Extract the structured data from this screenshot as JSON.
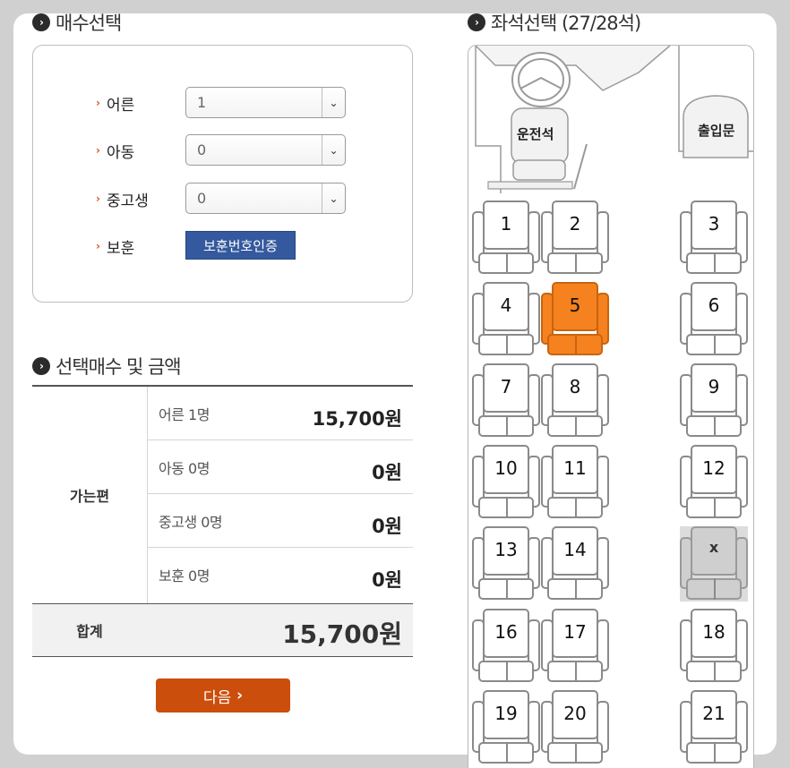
{
  "ticket_count": {
    "title": "매수선택",
    "rows": [
      {
        "label": "어른",
        "value": "1"
      },
      {
        "label": "아동",
        "value": "0"
      },
      {
        "label": "중고생",
        "value": "0"
      }
    ],
    "veteran_label": "보훈",
    "veteran_button": "보훈번호인증"
  },
  "summary": {
    "title": "선택매수 및 금액",
    "direction": "가는편",
    "items": [
      {
        "label": "어른 1명",
        "amount": "15,700원"
      },
      {
        "label": "아동 0명",
        "amount": "0원"
      },
      {
        "label": "중고생 0명",
        "amount": "0원"
      },
      {
        "label": "보훈 0명",
        "amount": "0원"
      }
    ],
    "total_label": "합계",
    "total_amount": "15,700원"
  },
  "next_button": "다음",
  "seat_map": {
    "title": "좌석선택 (27/28석)",
    "driver_label": "운전석",
    "door_label": "출입문",
    "selected_color": "#f5821f",
    "seats": [
      {
        "label": "1",
        "state": "available"
      },
      {
        "label": "2",
        "state": "available"
      },
      {
        "label": "3",
        "state": "available"
      },
      {
        "label": "4",
        "state": "available"
      },
      {
        "label": "5",
        "state": "selected"
      },
      {
        "label": "6",
        "state": "available"
      },
      {
        "label": "7",
        "state": "available"
      },
      {
        "label": "8",
        "state": "available"
      },
      {
        "label": "9",
        "state": "available"
      },
      {
        "label": "10",
        "state": "available"
      },
      {
        "label": "11",
        "state": "available"
      },
      {
        "label": "12",
        "state": "available"
      },
      {
        "label": "13",
        "state": "available"
      },
      {
        "label": "14",
        "state": "available"
      },
      {
        "label": "x",
        "state": "sold"
      },
      {
        "label": "16",
        "state": "available"
      },
      {
        "label": "17",
        "state": "available"
      },
      {
        "label": "18",
        "state": "available"
      },
      {
        "label": "19",
        "state": "available"
      },
      {
        "label": "20",
        "state": "available"
      },
      {
        "label": "21",
        "state": "available"
      }
    ]
  }
}
